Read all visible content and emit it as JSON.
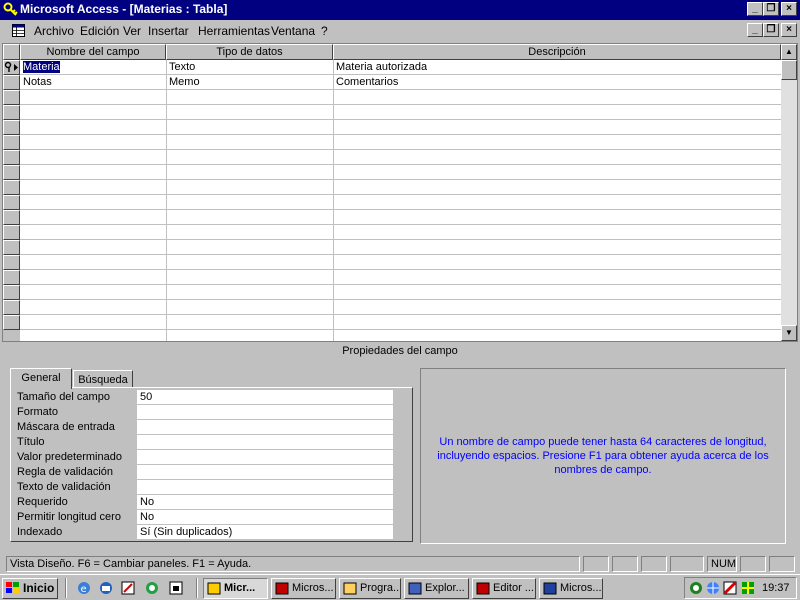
{
  "window": {
    "title": "Microsoft Access - [Materias : Tabla]"
  },
  "menu": [
    {
      "label": "Archivo"
    },
    {
      "label": "Edición"
    },
    {
      "label": "Ver"
    },
    {
      "label": "Insertar"
    },
    {
      "label": "Herramientas"
    },
    {
      "label": "Ventana"
    },
    {
      "label": "?"
    }
  ],
  "grid": {
    "headers": [
      "Nombre del campo",
      "Tipo de datos",
      "Descripción"
    ],
    "rows": [
      {
        "name": "Materia",
        "type": "Texto",
        "description": "Materia autorizada",
        "primary_key": true
      },
      {
        "name": "Notas",
        "type": "Memo",
        "description": "Comentarios",
        "primary_key": false
      }
    ]
  },
  "properties": {
    "header": "Propiedades del campo",
    "tabs": [
      {
        "label": "General"
      },
      {
        "label": "Búsqueda"
      }
    ],
    "rows": [
      {
        "label": "Tamaño del campo",
        "value": "50"
      },
      {
        "label": "Formato",
        "value": ""
      },
      {
        "label": "Máscara de entrada",
        "value": ""
      },
      {
        "label": "Título",
        "value": ""
      },
      {
        "label": "Valor predeterminado",
        "value": ""
      },
      {
        "label": "Regla de validación",
        "value": ""
      },
      {
        "label": "Texto de validación",
        "value": ""
      },
      {
        "label": "Requerido",
        "value": "No"
      },
      {
        "label": "Permitir longitud cero",
        "value": "No"
      },
      {
        "label": "Indexado",
        "value": "Sí (Sin duplicados)"
      }
    ],
    "help_text": "Un nombre de campo puede tener hasta 64 caracteres de longitud, incluyendo espacios. Presione F1 para obtener ayuda acerca de los nombres de campo."
  },
  "statusbar": {
    "text": "Vista Diseño.  F6 = Cambiar paneles.  F1 = Ayuda.",
    "num": "NUM"
  },
  "taskbar": {
    "start": "Inicio",
    "tasks": [
      {
        "label": "Micr...",
        "active": true
      },
      {
        "label": "Micros...",
        "active": false
      },
      {
        "label": "Progra...",
        "active": false
      },
      {
        "label": "Explor...",
        "active": false
      },
      {
        "label": "Editor ...",
        "active": false
      },
      {
        "label": "Micros...",
        "active": false
      }
    ],
    "clock": "19:37"
  },
  "colors": {
    "titlebar": "#000080",
    "help_text": "#0000ff",
    "desktop_gray": "#c0c0c0"
  }
}
